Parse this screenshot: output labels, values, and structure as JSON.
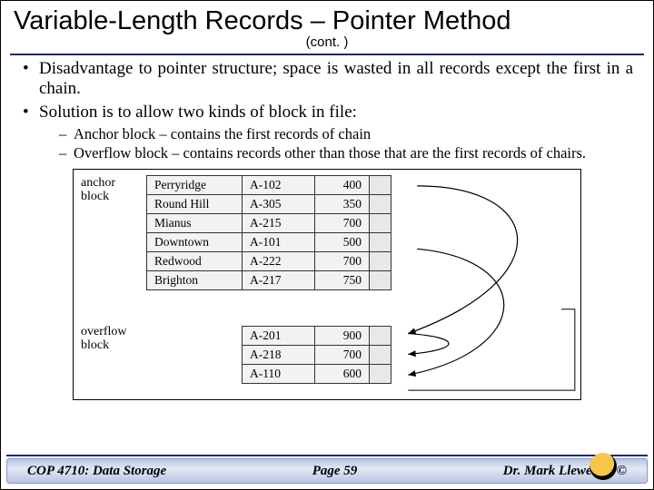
{
  "title": "Variable-Length Records – Pointer Method",
  "subtitle": "(cont. )",
  "bullets": [
    "Disadvantage to pointer structure; space is wasted in all records except the first in a chain.",
    "Solution is to allow two kinds of block in file:"
  ],
  "subbullets": [
    "Anchor block – contains the first records of chain",
    "Overflow block – contains records other than those that are the first records of chairs."
  ],
  "diagram": {
    "anchor_label": "anchor\nblock",
    "overflow_label": "overflow\nblock",
    "anchor_rows": [
      {
        "name": "Perryridge",
        "acct": "A-102",
        "amt": "400"
      },
      {
        "name": "Round Hill",
        "acct": "A-305",
        "amt": "350"
      },
      {
        "name": "Mianus",
        "acct": "A-215",
        "amt": "700"
      },
      {
        "name": "Downtown",
        "acct": "A-101",
        "amt": "500"
      },
      {
        "name": "Redwood",
        "acct": "A-222",
        "amt": "700"
      },
      {
        "name": "Brighton",
        "acct": "A-217",
        "amt": "750"
      }
    ],
    "overflow_rows": [
      {
        "acct": "A-201",
        "amt": "900"
      },
      {
        "acct": "A-218",
        "amt": "700"
      },
      {
        "acct": "A-110",
        "amt": "600"
      }
    ]
  },
  "footer": {
    "left": "COP 4710: Data Storage",
    "center": "Page 59",
    "right": "Dr. Mark Llewellyn ©"
  }
}
